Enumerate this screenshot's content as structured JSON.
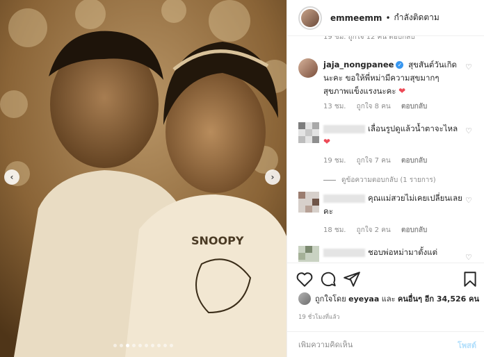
{
  "header": {
    "username": "emmeemm",
    "separator": "•",
    "follow_status": "กำลังติดตาม"
  },
  "comments_top_meta": "19 ชม.   ถูกใจ 12 คน   ตอบกลับ",
  "comments": [
    {
      "username": "jaja_nongpanee",
      "verified": true,
      "text": "สุขสันต์วันเกิดนะคะ ขอให้พี่หม่ามีความสุขมากๆ สุขภาพแข็งแรงนะคะ",
      "emoji": "❤",
      "time": "13 ชม.",
      "likes": "ถูกใจ 8 คน",
      "reply": "ตอบกลับ"
    },
    {
      "username": "",
      "text": "เลื่อนรูปดูแล้วน้ำตาจะไหล",
      "emoji": "❤",
      "time": "19 ชม.",
      "likes": "ถูกใจ 7 คน",
      "reply": "ตอบกลับ",
      "thread_toggle": "ดูข้อความตอบกลับ (1 รายการ)"
    },
    {
      "username": "",
      "text": "คุณแม่สวยไม่เคยเปลี่ยนเลยคะ",
      "time": "18 ชม.",
      "likes": "ถูกใจ 2 คน",
      "reply": "ตอบกลับ"
    },
    {
      "username": "",
      "text": "ชอบพ่อหม่ามาตั้งแต่"
    }
  ],
  "liked_by": {
    "prefix": "ถูกใจโดย",
    "user": "eyeyaa",
    "conj": "และ",
    "others": "คนอื่นๆ อีก 34,526 คน"
  },
  "timestamp": "19 ชั่วโมงที่แล้ว",
  "add_comment": {
    "placeholder": "เพิ่มความคิดเห็น",
    "post_label": "โพสต์"
  },
  "carousel": {
    "count": 10,
    "active_index": 2
  },
  "colors": {
    "verified": "#3897f0",
    "heart": "#ed4956",
    "post_disabled": "#b2dffc"
  },
  "icons": [
    "heart-icon",
    "comment-icon",
    "share-icon",
    "bookmark-icon",
    "chevron-left-icon",
    "chevron-right-icon"
  ]
}
